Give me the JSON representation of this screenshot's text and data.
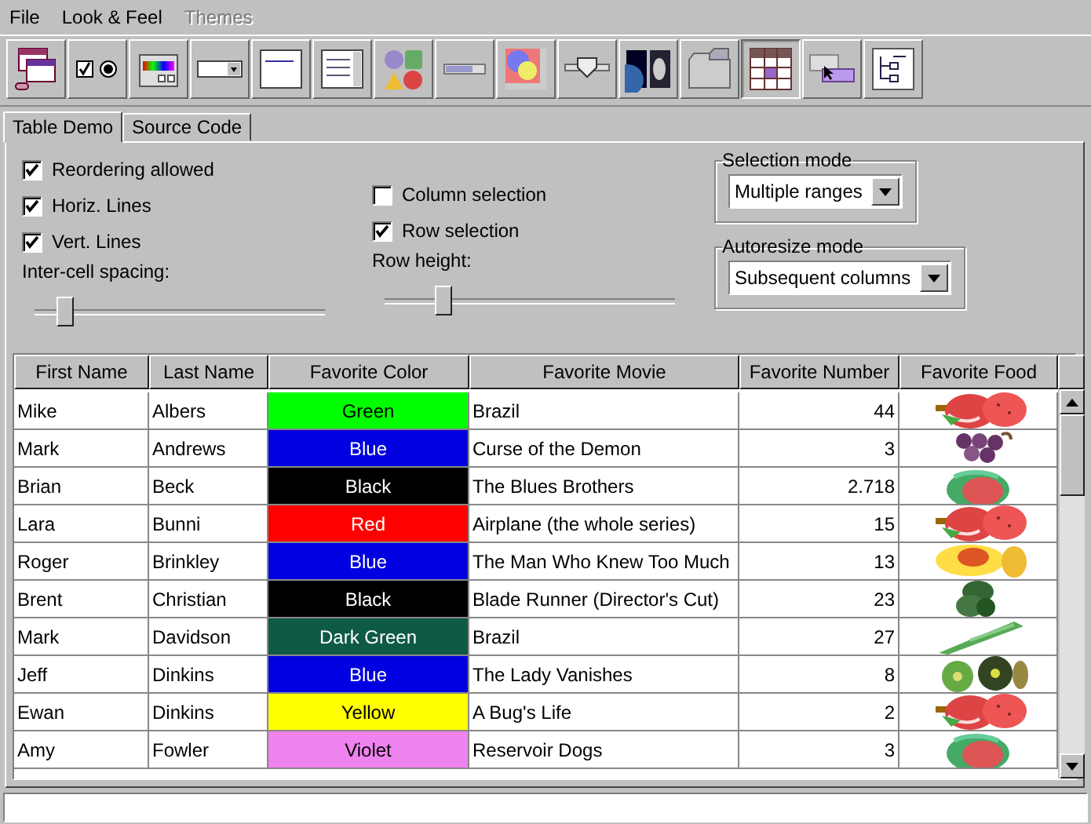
{
  "menu": [
    {
      "label": "File",
      "disabled": false
    },
    {
      "label": "Look & Feel",
      "disabled": false
    },
    {
      "label": "Themes",
      "disabled": true
    }
  ],
  "toolbar": [
    {
      "kind": "frames",
      "selected": false
    },
    {
      "kind": "buttons",
      "selected": false
    },
    {
      "kind": "chooser",
      "selected": false
    },
    {
      "kind": "combo",
      "selected": false
    },
    {
      "kind": "editor",
      "selected": false
    },
    {
      "kind": "list",
      "selected": false
    },
    {
      "kind": "dialogs",
      "selected": false
    },
    {
      "kind": "progress",
      "selected": false
    },
    {
      "kind": "scroll",
      "selected": false
    },
    {
      "kind": "slider",
      "selected": false
    },
    {
      "kind": "split",
      "selected": false
    },
    {
      "kind": "tabs",
      "selected": false
    },
    {
      "kind": "table",
      "selected": true
    },
    {
      "kind": "tooltip",
      "selected": false
    },
    {
      "kind": "tree",
      "selected": false
    }
  ],
  "tabs": [
    {
      "label": "Table Demo",
      "selected": true
    },
    {
      "label": "Source Code",
      "selected": false
    }
  ],
  "options": [
    {
      "label": "Reordering allowed",
      "checked": true
    },
    {
      "label": "Horiz. Lines",
      "checked": true
    },
    {
      "label": "Vert. Lines",
      "checked": true
    }
  ],
  "spacing": {
    "label": "Inter-cell spacing:",
    "level": 0.1
  },
  "selection_options": [
    {
      "label": "Column selection",
      "checked": false
    },
    {
      "label": "Row selection",
      "checked": true
    }
  ],
  "row_height": {
    "label": "Row height:",
    "level": 0.2
  },
  "selection_mode": {
    "title": "Selection mode",
    "value": "Multiple ranges"
  },
  "autoresize_mode": {
    "title": "Autoresize mode",
    "value": "Subsequent columns"
  },
  "table": {
    "columns": [
      "First Name",
      "Last Name",
      "Favorite Color",
      "Favorite Movie",
      "Favorite Number",
      "Favorite Food"
    ],
    "rows": [
      {
        "first": "Mike",
        "last": "Albers",
        "color_name": "Green",
        "color": "#00ff00",
        "movie": "Brazil",
        "number": "44",
        "kind": "strawberry"
      },
      {
        "first": "Mark",
        "last": "Andrews",
        "color_name": "Blue",
        "color": "#0000e0",
        "movie": "Curse of the Demon",
        "number": "3",
        "kind": "grapes"
      },
      {
        "first": "Brian",
        "last": "Beck",
        "color_name": "Black",
        "color": "#000000",
        "movie": "The Blues Brothers",
        "number": "2.718",
        "kind": "watermelon"
      },
      {
        "first": "Lara",
        "last": "Bunni",
        "color_name": "Red",
        "color": "#ff0000",
        "movie": "Airplane (the whole series)",
        "number": "15",
        "kind": "strawberry"
      },
      {
        "first": "Roger",
        "last": "Brinkley",
        "color_name": "Blue",
        "color": "#0000e0",
        "movie": "The Man Who Knew Too Much",
        "number": "13",
        "kind": "peach"
      },
      {
        "first": "Brent",
        "last": "Christian",
        "color_name": "Black",
        "color": "#000000",
        "movie": "Blade Runner (Director's Cut)",
        "number": "23",
        "kind": "broccoli"
      },
      {
        "first": "Mark",
        "last": "Davidson",
        "color_name": "Dark Green",
        "color": "#0e5a44",
        "movie": "Brazil",
        "number": "27",
        "kind": "asparagus"
      },
      {
        "first": "Jeff",
        "last": "Dinkins",
        "color_name": "Blue",
        "color": "#0000e0",
        "movie": "The Lady Vanishes",
        "number": "8",
        "kind": "kiwi"
      },
      {
        "first": "Ewan",
        "last": "Dinkins",
        "color_name": "Yellow",
        "color": "#ffff00",
        "movie": "A Bug's Life",
        "number": "2",
        "kind": "strawberry"
      },
      {
        "first": "Amy",
        "last": "Fowler",
        "color_name": "Violet",
        "color": "#ee82ee",
        "movie": "Reservoir Dogs",
        "number": "3",
        "kind": "watermelon"
      }
    ]
  }
}
